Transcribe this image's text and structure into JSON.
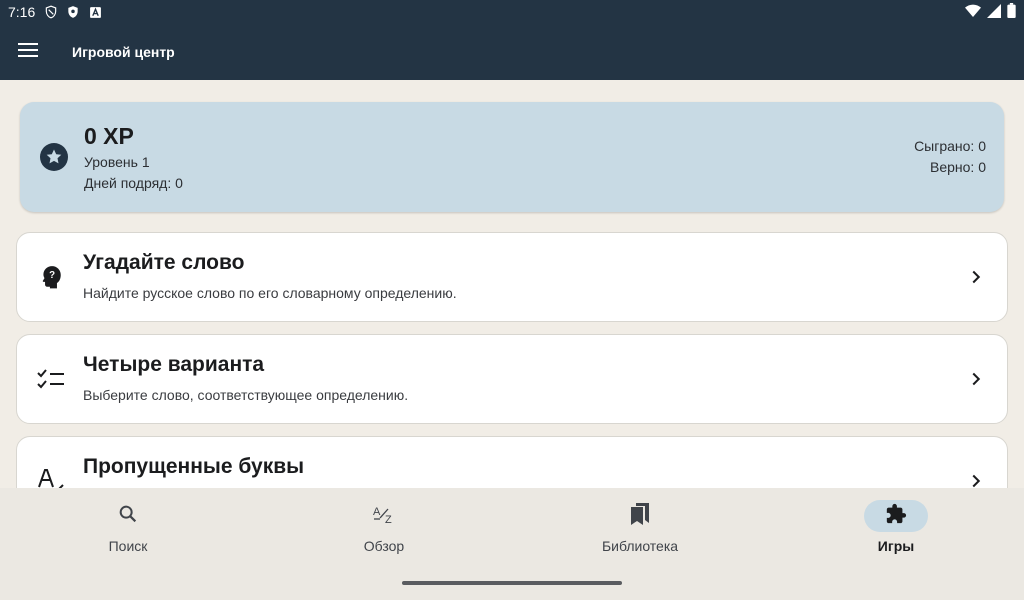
{
  "status": {
    "time": "7:16"
  },
  "appbar": {
    "title": "Игровой центр"
  },
  "stats": {
    "xp": "0 XP",
    "level": "Уровень 1",
    "streak": "Дней подряд: 0",
    "played": "Сыграно: 0",
    "correct": "Верно: 0"
  },
  "games": [
    {
      "title": "Угадайте слово",
      "description": "Найдите русское слово по его словарному определению.",
      "icon": "question-head-icon"
    },
    {
      "title": "Четыре варианта",
      "description": "Выберите слово, соответствующее определению.",
      "icon": "checklist-icon"
    },
    {
      "title": "Пропущенные буквы",
      "description": "",
      "icon": "spellcheck-icon"
    }
  ],
  "nav": {
    "items": [
      {
        "label": "Поиск",
        "icon": "search-icon"
      },
      {
        "label": "Обзор",
        "icon": "sort-az-icon"
      },
      {
        "label": "Библиотека",
        "icon": "bookmarks-icon"
      },
      {
        "label": "Игры",
        "icon": "puzzle-icon",
        "active": true
      }
    ]
  },
  "colors": {
    "appbar": "#233444",
    "background": "#f1ede6",
    "stats_card": "#c8dae4",
    "nav_background": "#ebe8e2",
    "active_pill": "#c8dae4"
  }
}
